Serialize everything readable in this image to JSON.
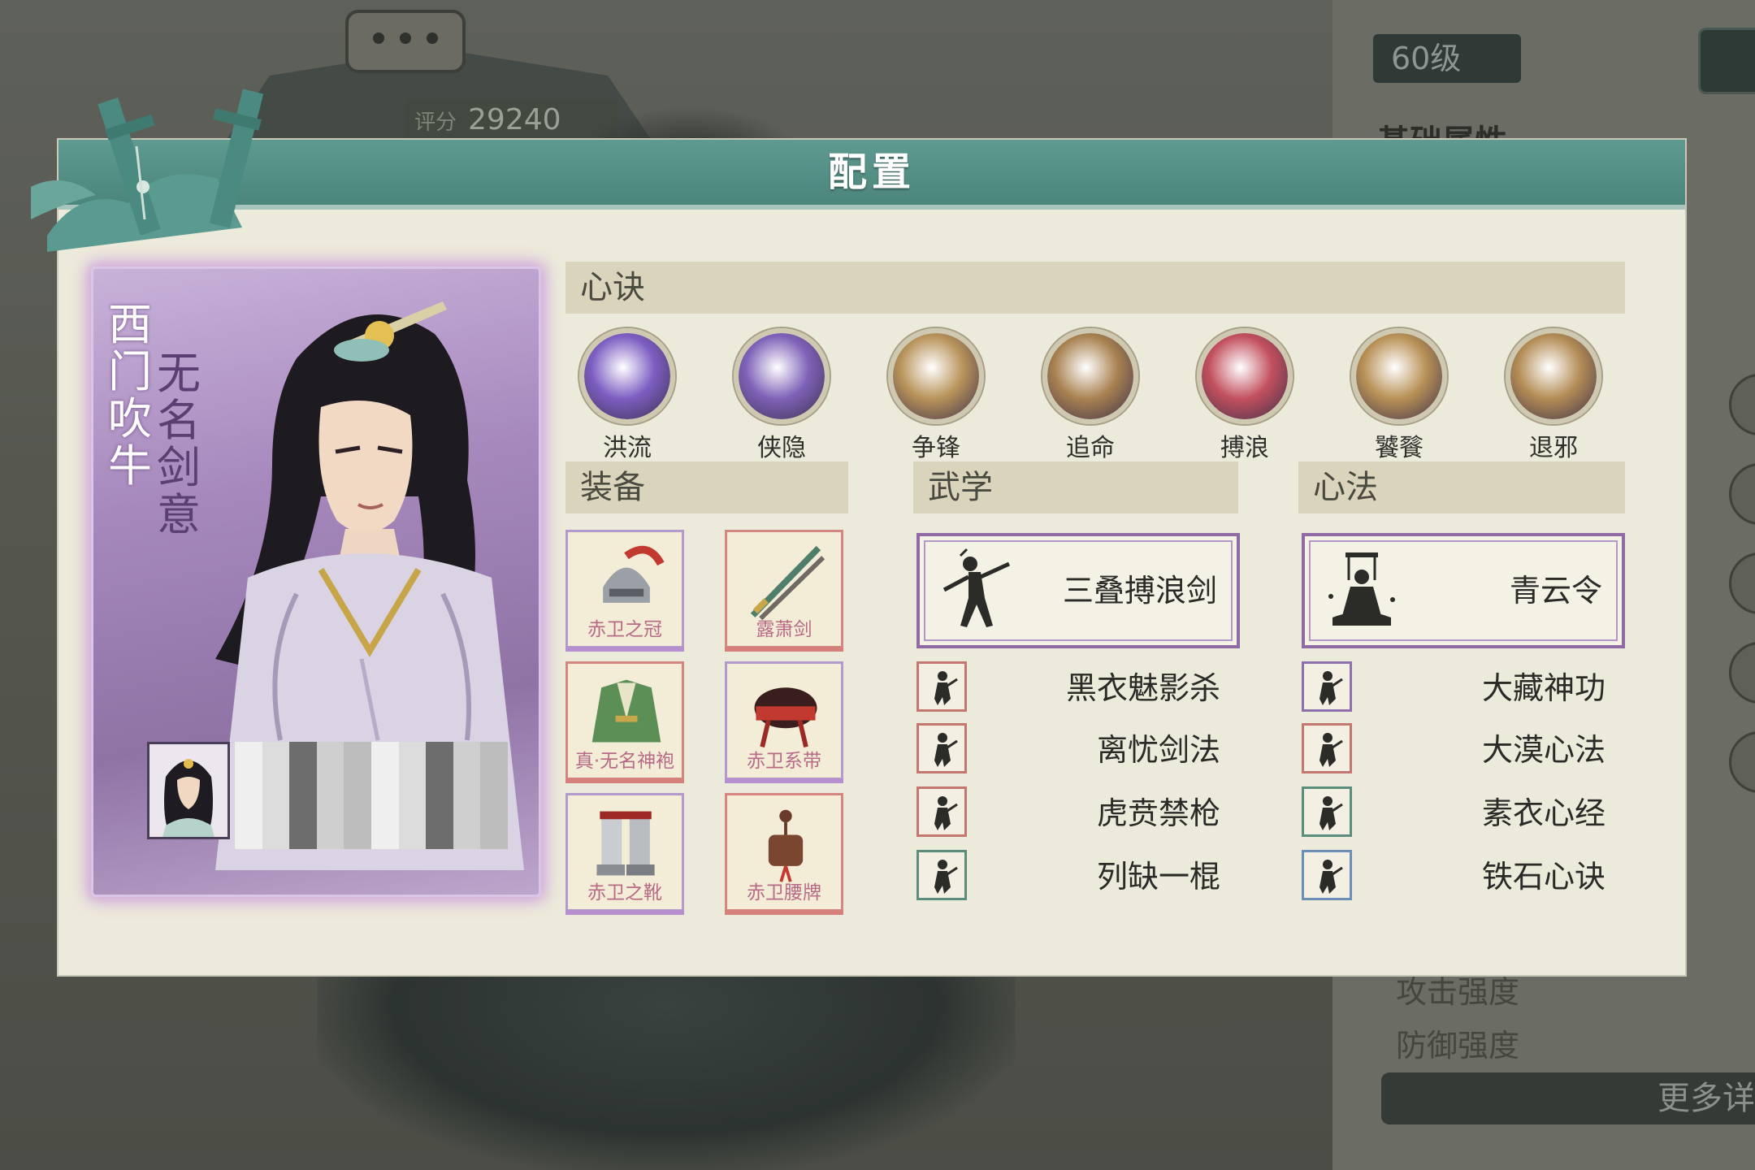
{
  "background": {
    "score_label": "评分",
    "score_value": "29240",
    "level": "60级",
    "basic_attributes_heading": "基础属性",
    "stats": [
      "攻击强度",
      "防御强度"
    ],
    "more_details": "更多详"
  },
  "dialog": {
    "title": "配置"
  },
  "character": {
    "name": "西门吹牛",
    "title": "无名剑意"
  },
  "xinjue": {
    "heading": "心诀",
    "items": [
      {
        "label": "洪流",
        "color": "#7d5ec2"
      },
      {
        "label": "侠隐",
        "color": "#7f62b8"
      },
      {
        "label": "争锋",
        "color": "#b8935a"
      },
      {
        "label": "追命",
        "color": "#a98251"
      },
      {
        "label": "搏浪",
        "color": "#c2505e"
      },
      {
        "label": "饕餮",
        "color": "#b89156"
      },
      {
        "label": "退邪",
        "color": "#b38c55"
      }
    ]
  },
  "equipment": {
    "heading": "装备",
    "items": [
      {
        "label": "赤卫之冠",
        "frame": "purple"
      },
      {
        "label": "露萧剑",
        "frame": "red"
      },
      {
        "label": "真·无名神袍",
        "frame": "red"
      },
      {
        "label": "赤卫系带",
        "frame": "purple"
      },
      {
        "label": "赤卫之靴",
        "frame": "purple"
      },
      {
        "label": "赤卫腰牌",
        "frame": "red"
      }
    ]
  },
  "wuxue": {
    "heading": "武学",
    "main": "三叠搏浪剑",
    "list": [
      {
        "name": "黑衣魅影杀",
        "frame": "red"
      },
      {
        "name": "离忧剑法",
        "frame": "red"
      },
      {
        "name": "虎贲禁枪",
        "frame": "red"
      },
      {
        "name": "列缺一棍",
        "frame": "green"
      }
    ]
  },
  "xinfa": {
    "heading": "心法",
    "main": "青云令",
    "list": [
      {
        "name": "大藏神功",
        "frame": "purple"
      },
      {
        "name": "大漠心法",
        "frame": "red"
      },
      {
        "name": "素衣心经",
        "frame": "green"
      },
      {
        "name": "铁石心诀",
        "frame": "blue"
      }
    ]
  }
}
